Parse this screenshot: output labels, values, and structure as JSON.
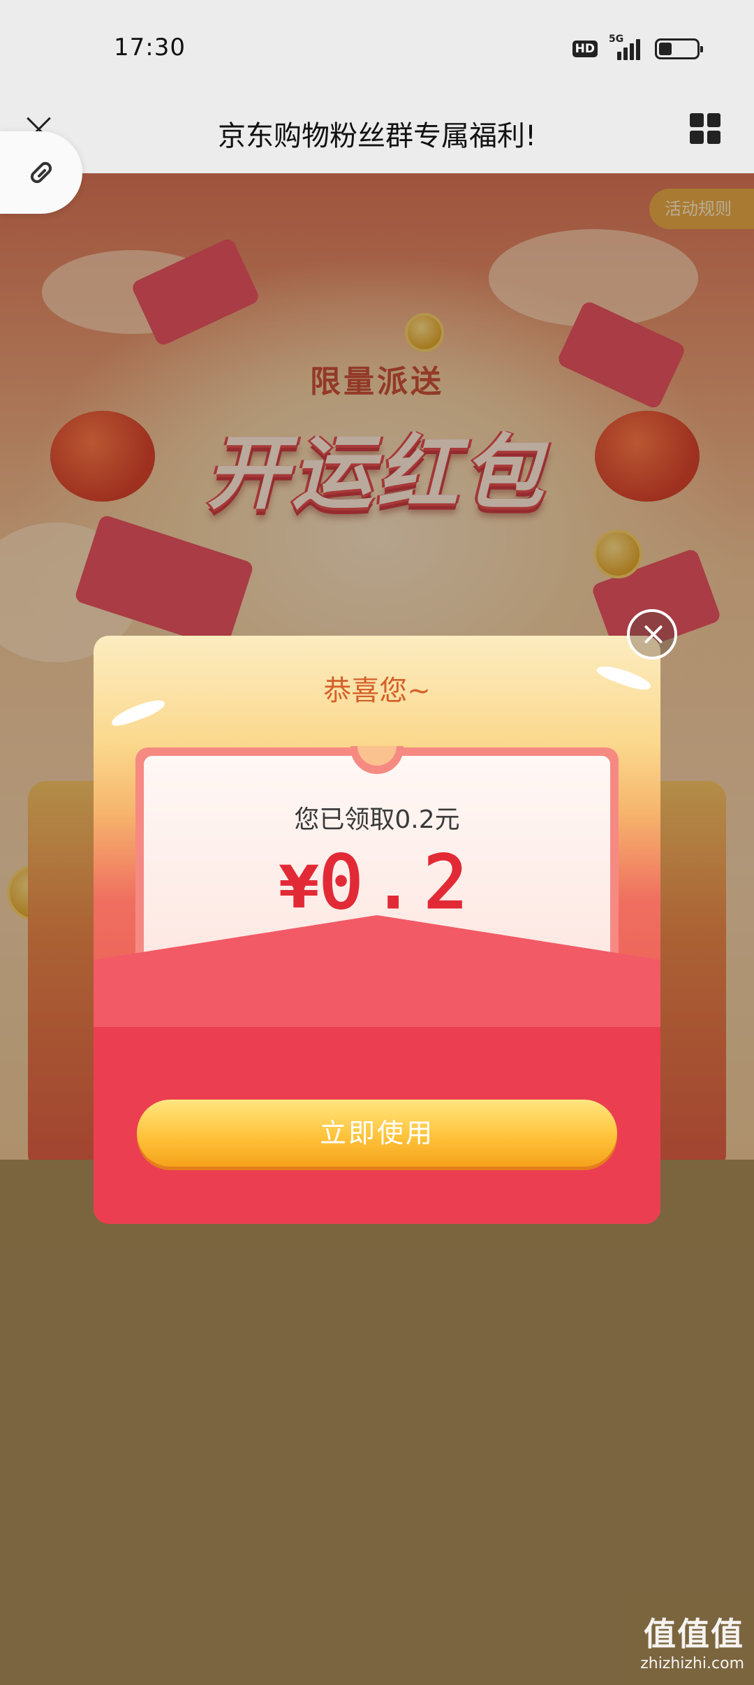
{
  "status_bar": {
    "time": "17:30",
    "hd_badge": "HD",
    "network": "5G",
    "signal_icon": "signal-bars-icon",
    "battery_icon": "battery-icon"
  },
  "title_bar": {
    "title": "京东购物粉丝群专属福利!",
    "close_icon": "close-icon",
    "menu_icon": "grid-menu-icon",
    "link_icon": "link-icon"
  },
  "campaign": {
    "rules_button": "活动规则",
    "limited_tag": "限量派送",
    "slogan": "开运红包"
  },
  "modal": {
    "congrats": "恭喜您~",
    "received_text": "您已领取0.2元",
    "currency_symbol": "¥",
    "amount": "0.2",
    "use_button": "立即使用",
    "close_icon": "close-circle-icon"
  },
  "watermark": {
    "logo": "值值值",
    "site": "zhizhizhi.com"
  },
  "colors": {
    "title_bar_bg": "#ececec",
    "amount_red": "#e22a36",
    "button_gold": "#ffc33b",
    "page_bottom": "#9c8251"
  }
}
